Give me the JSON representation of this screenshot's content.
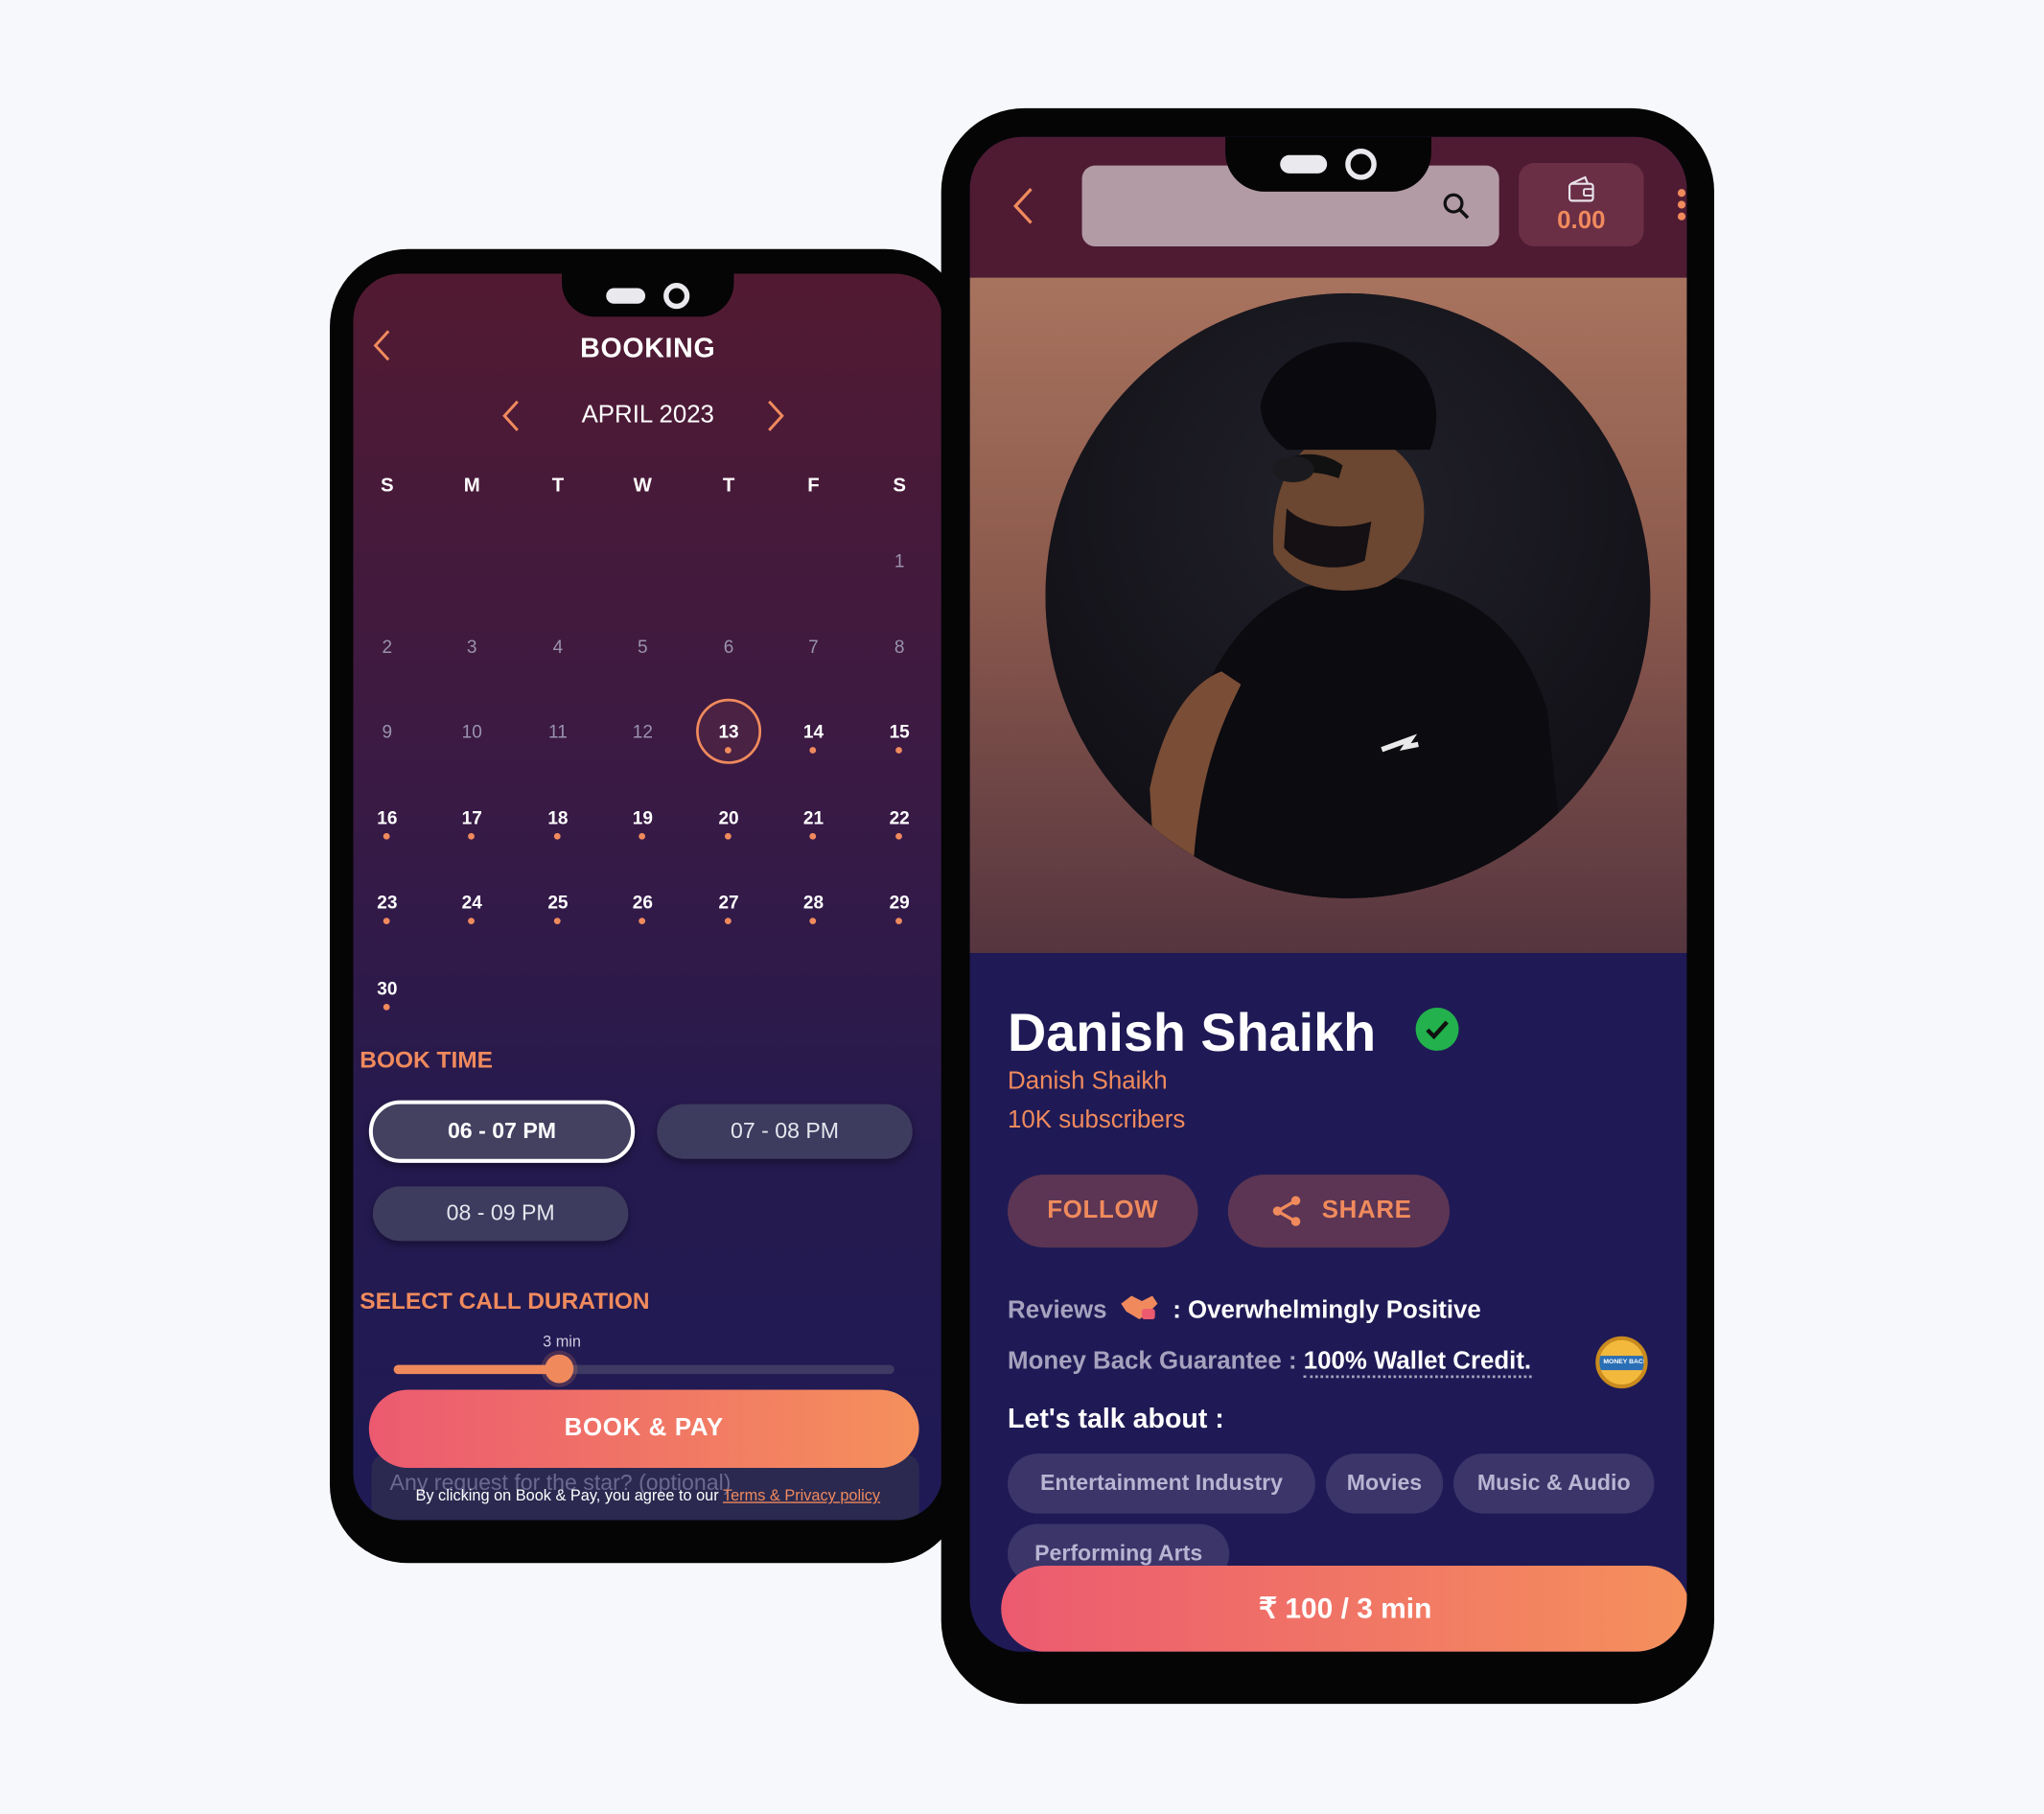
{
  "booking": {
    "title": "BOOKING",
    "month": "APRIL 2023",
    "weekdays": [
      "S",
      "M",
      "T",
      "W",
      "T",
      "F",
      "S"
    ],
    "days": [
      {
        "n": "1",
        "available": false
      },
      {
        "n": "2",
        "available": false
      },
      {
        "n": "3",
        "available": false
      },
      {
        "n": "4",
        "available": false
      },
      {
        "n": "5",
        "available": false
      },
      {
        "n": "6",
        "available": false
      },
      {
        "n": "7",
        "available": false
      },
      {
        "n": "8",
        "available": false
      },
      {
        "n": "9",
        "available": false
      },
      {
        "n": "10",
        "available": false
      },
      {
        "n": "11",
        "available": false
      },
      {
        "n": "12",
        "available": false
      },
      {
        "n": "13",
        "available": true,
        "selected": true
      },
      {
        "n": "14",
        "available": true
      },
      {
        "n": "15",
        "available": true
      },
      {
        "n": "16",
        "available": true
      },
      {
        "n": "17",
        "available": true
      },
      {
        "n": "18",
        "available": true
      },
      {
        "n": "19",
        "available": true
      },
      {
        "n": "20",
        "available": true
      },
      {
        "n": "21",
        "available": true
      },
      {
        "n": "22",
        "available": true
      },
      {
        "n": "23",
        "available": true
      },
      {
        "n": "24",
        "available": true
      },
      {
        "n": "25",
        "available": true
      },
      {
        "n": "26",
        "available": true
      },
      {
        "n": "27",
        "available": true
      },
      {
        "n": "28",
        "available": true
      },
      {
        "n": "29",
        "available": true
      },
      {
        "n": "30",
        "available": true
      }
    ],
    "book_time_label": "BOOK TIME",
    "time_slots": [
      {
        "label": "06 - 07 PM",
        "selected": true
      },
      {
        "label": "07 - 08 PM",
        "selected": false
      },
      {
        "label": "08 - 09 PM",
        "selected": false
      }
    ],
    "duration_label": "SELECT CALL DURATION",
    "duration_value": "3 min",
    "duration_fraction": 0.33,
    "request_placeholder": "Any request for the star? (optional)",
    "book_pay_label": "BOOK & PAY",
    "terms_prefix": "By clicking on Book & Pay, you agree to our",
    "terms_link": "Terms & Privacy policy"
  },
  "profile": {
    "wallet_balance": "0.00",
    "name": "Danish Shaikh",
    "handle": "Danish Shaikh",
    "subscribers": "10K subscribers",
    "follow_label": "FOLLOW",
    "share_label": "SHARE",
    "reviews_label": "Reviews",
    "reviews_value": ": Overwhelmingly Positive",
    "guarantee_label": "Money Back Guarantee :",
    "guarantee_value": "100% Wallet Credit.",
    "badge_text": "MONEY BACK",
    "talk_label": "Let's talk about :",
    "topics": [
      "Entertainment Industry",
      "Movies",
      "Music & Audio",
      "Performing Arts"
    ],
    "price_label": "₹ 100 / 3 min"
  },
  "colors": {
    "accent": "#f08a5d",
    "background": "#1f1a55",
    "verified": "#22b14c"
  }
}
